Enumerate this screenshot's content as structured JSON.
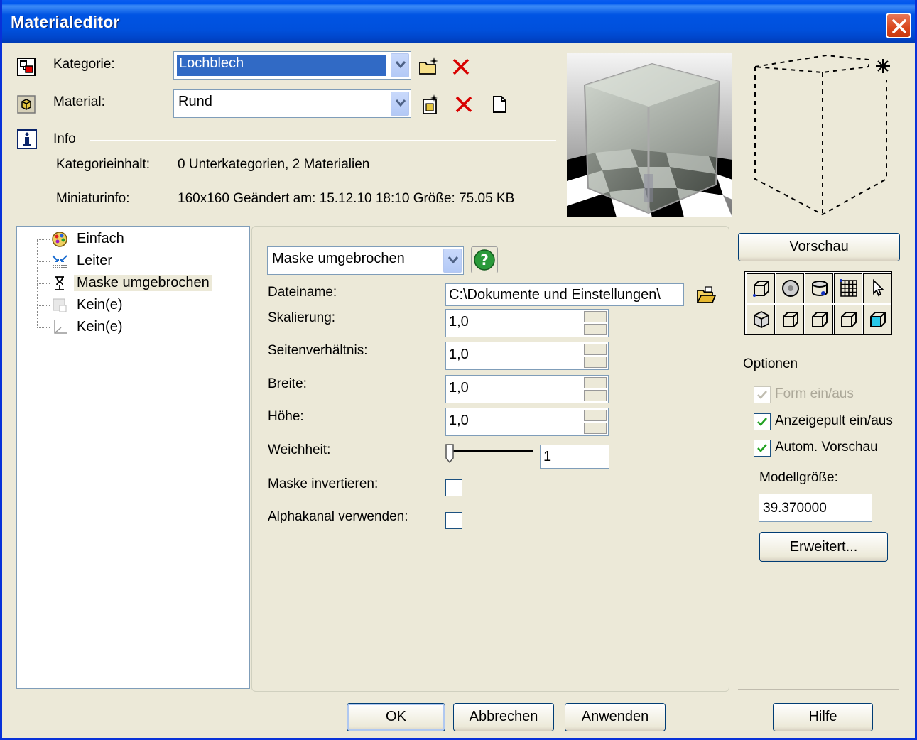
{
  "window": {
    "title": "Materialeditor"
  },
  "category": {
    "label": "Kategorie:",
    "value": "Lochblech"
  },
  "material": {
    "label": "Material:",
    "value": "Rund"
  },
  "info": {
    "heading": "Info",
    "category_content_label": "Kategorieinhalt:",
    "category_content_value": "0 Unterkategorien,  2 Materialien",
    "thumbnail_label": "Miniaturinfo:",
    "thumbnail_value": "160x160  Geändert am: 15.12.10 18:10 Größe: 75.05  KB"
  },
  "tree": {
    "items": [
      {
        "label": "Einfach",
        "icon": "palette-icon"
      },
      {
        "label": "Leiter",
        "icon": "arrows-icon"
      },
      {
        "label": "Maske umgebrochen",
        "icon": "hourglass-icon",
        "selected": true
      },
      {
        "label": "Kein(e)",
        "icon": "blank-map-icon"
      },
      {
        "label": "Kein(e)",
        "icon": "axis-icon"
      }
    ]
  },
  "map": {
    "type_value": "Maske umgebrochen",
    "filename_label": "Dateiname:",
    "filename_value": "C:\\Dokumente und Einstellungen\\",
    "scale_label": "Skalierung:",
    "scale_value": "1,0",
    "aspect_label": "Seitenverhältnis:",
    "aspect_value": "1,0",
    "width_label": "Breite:",
    "width_value": "1,0",
    "height_label": "Höhe:",
    "height_value": "1,0",
    "softness_label": "Weichheit:",
    "softness_value": "1",
    "invert_label": "Maske invertieren:",
    "invert_checked": false,
    "alpha_label": "Alphakanal verwenden:",
    "alpha_checked": false
  },
  "preview_button": "Vorschau",
  "options": {
    "heading": "Optionen",
    "shape_label": "Form ein/aus",
    "shape_checked": true,
    "shape_disabled": true,
    "panel_label": "Anzeigepult ein/aus",
    "panel_checked": true,
    "autopreview_label": "Autom. Vorschau",
    "autopreview_checked": true,
    "model_size_label": "Modellgröße:",
    "model_size_value": "39.370000",
    "advanced_button": "Erweitert..."
  },
  "buttons": {
    "ok": "OK",
    "cancel": "Abbrechen",
    "apply": "Anwenden",
    "help": "Hilfe"
  }
}
